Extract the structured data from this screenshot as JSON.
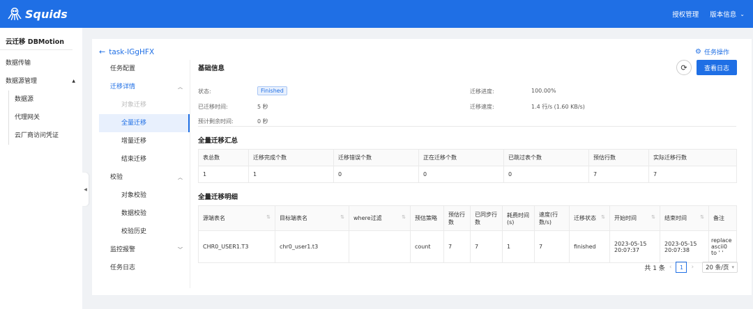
{
  "topbar": {
    "brand": "Squids",
    "nav": [
      {
        "label": "授权管理"
      },
      {
        "label": "版本信息"
      }
    ]
  },
  "sidebar": {
    "title": "云迁移 DBMotion",
    "items": [
      {
        "label": "数据传输"
      },
      {
        "label": "数据源管理"
      }
    ],
    "sub_items": [
      {
        "label": "数据源"
      },
      {
        "label": "代理网关"
      },
      {
        "label": "云厂商访问凭证"
      }
    ]
  },
  "task": {
    "name": "task-IGgHFX",
    "operations_label": "任务操作"
  },
  "submenu": {
    "task_config": "任务配置",
    "migration_detail": "迁移详情",
    "object_migration": "对象迁移",
    "full_migration": "全量迁移",
    "incremental_migration": "增量迁移",
    "end_migration": "结束迁移",
    "verify": "校验",
    "object_verify": "对象校验",
    "data_verify": "数据校验",
    "verify_history": "校验历史",
    "monitor_alert": "监控报警",
    "task_log": "任务日志"
  },
  "basic_info": {
    "title": "基础信息",
    "view_log_label": "查看日志",
    "status_label": "状态:",
    "status_value": "Finished",
    "elapsed_label": "已迁移时间:",
    "elapsed_value": "5 秒",
    "remaining_label": "预计剩余时间:",
    "remaining_value": "0 秒",
    "progress_label": "迁移进度:",
    "progress_value": "100.00%",
    "speed_label": "迁移速度:",
    "speed_value": "1.4 行/s (1.60 KB/s)"
  },
  "summary": {
    "title": "全量迁移汇总",
    "columns": [
      "表总数",
      "迁移完成个数",
      "迁移错误个数",
      "正在迁移个数",
      "已跳过表个数",
      "预估行数",
      "实际迁移行数"
    ],
    "row": [
      "1",
      "1",
      "0",
      "0",
      "0",
      "7",
      "7"
    ]
  },
  "detail": {
    "title": "全量迁移明细",
    "columns": [
      "源端表名",
      "目标端表名",
      "where过滤",
      "预估策略",
      "预估行数",
      "已同步行数",
      "耗费时间(s)",
      "速度(行数/s)",
      "迁移状态",
      "开始时间",
      "结束时间",
      "备注"
    ],
    "row": [
      "CHR0_USER1.T3",
      "chr0_user1.t3",
      "",
      "count",
      "7",
      "7",
      "1",
      "7",
      "finished",
      "2023-05-15 20:07:37",
      "2023-05-15 20:07:38",
      "replace ascii0 to ' '"
    ]
  },
  "pager": {
    "total": "共 1 条",
    "page": "1",
    "page_size": "20 条/页"
  }
}
